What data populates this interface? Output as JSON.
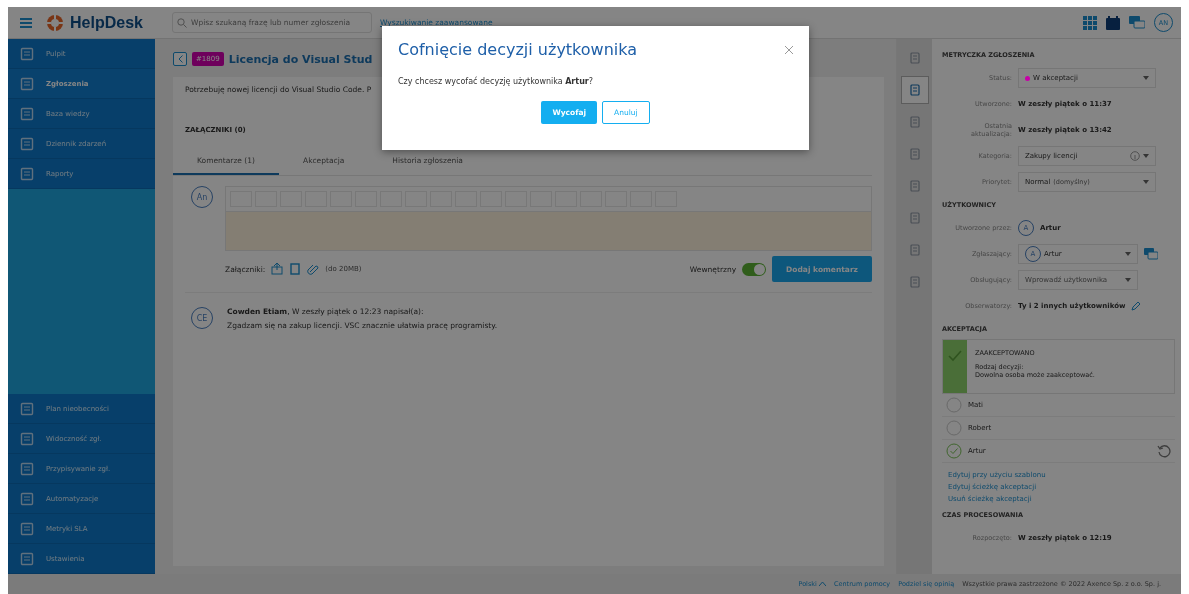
{
  "topbar": {
    "logo": "HelpDesk",
    "search": {
      "placeholder": "Wpisz szukaną frazę lub numer zgłoszenia"
    },
    "advanced_link": "Wyszukiwanie zaawansowane",
    "avatar": "AN"
  },
  "sidebar": {
    "items": [
      {
        "label": "Pulpit",
        "selected": false
      },
      {
        "label": "Zgłoszenia",
        "selected": true
      },
      {
        "label": "Baza wiedzy",
        "selected": false
      },
      {
        "label": "Dziennik zdarzeń",
        "selected": false
      },
      {
        "label": "Raporty",
        "selected": false
      }
    ],
    "bottom_items": [
      {
        "label": "Plan nieobecności",
        "selected": false
      },
      {
        "label": "Widoczność zgł.",
        "selected": false
      },
      {
        "label": "Przypisywanie zgł.",
        "selected": false
      },
      {
        "label": "Automatyzacje",
        "selected": false
      },
      {
        "label": "Metryki SLA",
        "selected": false
      },
      {
        "label": "Ustawienia",
        "selected": false
      }
    ]
  },
  "ticket": {
    "badge": "#1809",
    "title": "Licencja do Visual Stud",
    "description": "Potrzebuję nowej licencji do Visual Studio Code. P",
    "attachments_heading": "ZAŁĄCZNIKI (0)",
    "tabs": [
      {
        "label": "Komentarze (1)",
        "selected": true
      },
      {
        "label": "Akceptacja",
        "selected": false
      },
      {
        "label": "Historia zgłoszenia",
        "selected": false
      }
    ],
    "editor": {
      "avatar": "An",
      "attachments_label": "Załączniki:",
      "size_note": "(do 20MB)",
      "internal_label": "Wewnętrzny",
      "internal": true,
      "submit": "Dodaj komentarz"
    },
    "comments": [
      {
        "avatar": "CE",
        "author": "Cowden Etiam",
        "meta": ", W zeszły piątek o 12:23 napisał(a):",
        "text": "Zgadzam się na zakup licencji. VSC znacznie ułatwia pracę programisty."
      }
    ]
  },
  "rail": {
    "items": [
      {
        "selected": false
      },
      {
        "selected": true
      },
      {
        "selected": false
      },
      {
        "selected": false
      },
      {
        "selected": false
      },
      {
        "selected": false
      },
      {
        "selected": false
      },
      {
        "selected": false
      }
    ]
  },
  "details": {
    "heading": "METRYCZKA ZGŁOSZENIA",
    "rows": [
      {
        "kind": "select",
        "label": "Status:",
        "value": "W akceptacji",
        "color": "#c800a8"
      },
      {
        "kind": "text",
        "label": "Utworzone:",
        "value": "W zeszły piątek o 11:37"
      },
      {
        "kind": "text",
        "label": "Ostatnia aktualizacja:",
        "value": "W zeszły piątek o 13:42"
      },
      {
        "kind": "select",
        "label": "Kategoria:",
        "value": "Zakupy licencji",
        "info": true
      },
      {
        "kind": "select",
        "label": "Priorytet:",
        "value": "Normal",
        "note": "(domyślny)"
      }
    ],
    "users_heading": "UŻYTKOWNICY",
    "users": [
      {
        "kind": "user",
        "label": "Utworzone przez:",
        "value": "Artur",
        "avatar": "A"
      },
      {
        "kind": "user-select",
        "label": "Zgłaszający:",
        "value": "Artur",
        "avatar": "A"
      },
      {
        "kind": "placeholder-select",
        "label": "Obsługujący:",
        "placeholder": "Wprowadź użytkownika"
      },
      {
        "kind": "observers",
        "label": "Obserwatorzy:",
        "value": "Ty i 2 innych użytkowników"
      }
    ],
    "acceptance_heading": "AKCEPTACJA",
    "acceptance": {
      "status": "ZAAKCEPTOWANO",
      "accepted": true,
      "type_label": "Rodzaj decyzji:",
      "type": "Dowolna osoba może zaakceptować."
    },
    "approvers": [
      {
        "name": "Mati",
        "approved": false
      },
      {
        "name": "Robert",
        "approved": false
      },
      {
        "name": "Artur",
        "approved": true
      }
    ],
    "links": [
      "Edytuj przy użyciu szablonu",
      "Edytuj ścieżkę akceptacji",
      "Usuń ścieżkę akceptacji"
    ],
    "time_heading": "CZAS PROCESOWANIA",
    "time": {
      "label": "Rozpoczęto:",
      "value": "W zeszły piątek o 12:19"
    }
  },
  "footer": {
    "language": "Polski",
    "links": [
      "Centrum pomocy",
      "Podziel się opinią"
    ],
    "copyright": "Wszystkie prawa zastrzeżone © 2022 Axence Sp. z o.o. Sp. j."
  },
  "dialog": {
    "title": "Cofnięcie decyzji użytkownika",
    "message": "Czy chcesz wycofać decyzję użytkownika **Artur**?",
    "buttons": [
      {
        "label": "Wycofaj",
        "kind": "primary"
      },
      {
        "label": "Anuluj",
        "kind": "secondary"
      }
    ]
  }
}
